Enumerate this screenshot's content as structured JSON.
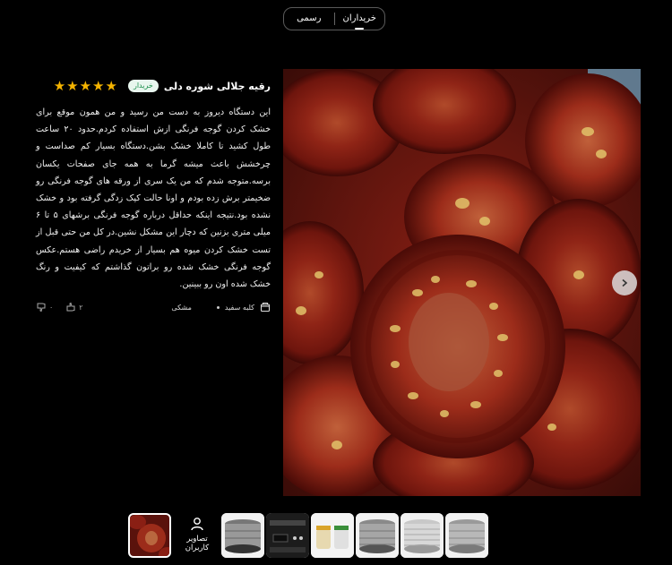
{
  "tabs": [
    {
      "label": "رسمی",
      "active": false
    },
    {
      "label": "خریداران",
      "active": true
    }
  ],
  "review": {
    "reviewer_name": "رقیه جلالی شوره دلی",
    "badge": "خریدار",
    "rating": 5,
    "body": "این دستگاه دیروز به دست من رسید و من همون موقع برای خشک کردن گوجه فرنگی ازش استفاده کردم.حدود ۲۰ ساعت طول کشید تا کاملا خشک بشن.دستگاه بسیار کم صداست و چرخشش باعث میشه گرما به همه جای صفحات یکسان برسه.متوجه شدم که من یک سری از ورقه های گوجه فرنگی رو ضخیمتر برش زده بودم و اونا حالت کپک زدگی گرفته بود و خشک نشده بود.نتیجه اینکه حداقل درباره گوجه فرنگی برشهای ۵ تا ۶ میلی متری بزنین که دچار این مشکل نشین.در کل من حتی قبل از تست خشک کردن میوه هم بسیار از خریدم راضی هستم.عکس گوجه فرنگی خشک شده رو براتون گذاشتم که کیفیت و رنگ خشک شده اون رو ببینین.",
    "variant": "کلبه سفید",
    "color": "مشکی",
    "likes": "۲",
    "dislikes": "۰"
  },
  "thumbnails": {
    "user_images_label": "تصاویر کاربران"
  },
  "colors": {
    "background": "#000000",
    "star": "#f5b400",
    "badge_text": "#1b8f4c",
    "badge_bg": "#e8f6ee"
  }
}
